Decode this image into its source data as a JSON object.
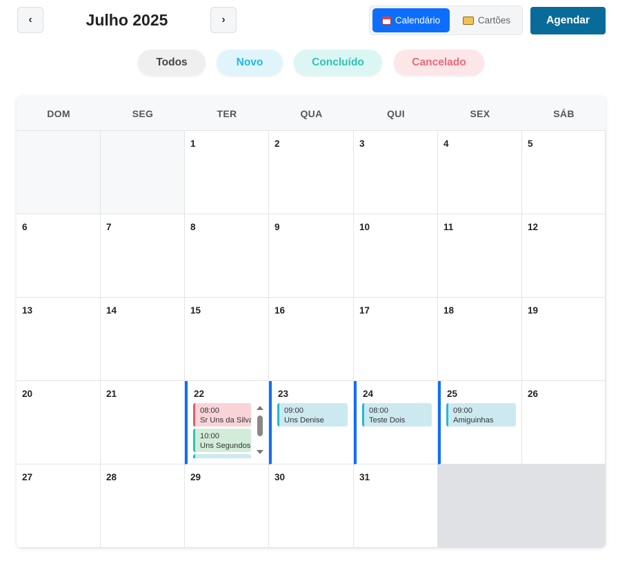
{
  "header": {
    "prev_label": "‹",
    "next_label": "›",
    "month_title": "Julho 2025",
    "view_calendar_label": "Calendário",
    "view_cards_label": "Cartões",
    "schedule_button_label": "Agendar"
  },
  "filters": {
    "all": "Todos",
    "new": "Novo",
    "completed": "Concluído",
    "cancelled": "Cancelado"
  },
  "colors": {
    "primary": "#0d6efd",
    "schedule_button": "#096b9a",
    "status_new": "#20b8dc",
    "status_completed": "#2fc3b8",
    "status_cancelled": "#e35a6a"
  },
  "weekdays": [
    "DOM",
    "SEG",
    "TER",
    "QUA",
    "QUI",
    "SEX",
    "SÁB"
  ],
  "weeks": [
    [
      null,
      null,
      1,
      2,
      3,
      4,
      5
    ],
    [
      6,
      7,
      8,
      9,
      10,
      11,
      12
    ],
    [
      13,
      14,
      15,
      16,
      17,
      18,
      19
    ],
    [
      20,
      21,
      22,
      23,
      24,
      25,
      26
    ],
    [
      27,
      28,
      29,
      30,
      31,
      null,
      null
    ]
  ],
  "events": {
    "22": [
      {
        "time": "08:00",
        "name": "Sr Uns da Silva",
        "status": "cancelado"
      },
      {
        "time": "10:00",
        "name": "Uns Segundos",
        "status": "concluido"
      },
      {
        "time": "",
        "name": "",
        "status": "novo"
      }
    ],
    "23": [
      {
        "time": "09:00",
        "name": "Uns Denise",
        "status": "novo"
      }
    ],
    "24": [
      {
        "time": "08:00",
        "name": "Teste Dois",
        "status": "novo"
      }
    ],
    "25": [
      {
        "time": "09:00",
        "name": "Amiguinhas",
        "status": "novo"
      }
    ]
  }
}
